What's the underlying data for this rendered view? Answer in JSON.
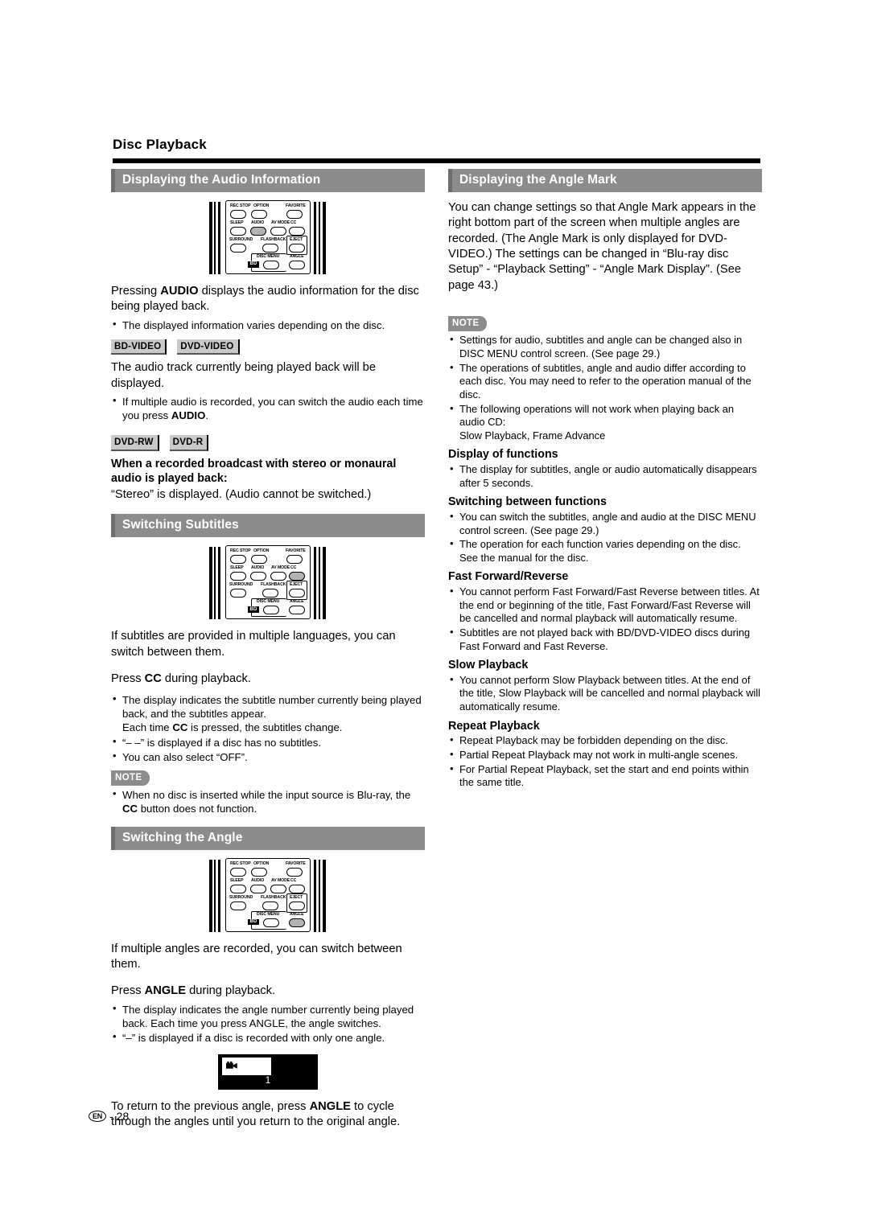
{
  "page": {
    "title": "Disc Playback",
    "footer_locale": "EN",
    "footer_sep": "-",
    "footer_page": "28"
  },
  "remote": {
    "labels": {
      "rec_stop": "REC STOP",
      "option": "OPTION",
      "favorite": "FAVORITE",
      "sleep": "SLEEP",
      "audio": "AUDIO",
      "av_mode": "AV MODE",
      "cc": "CC",
      "surround": "SURROUND",
      "flashback": "FLASHBACK",
      "eject": "EJECT",
      "disc_menu": "DISC MENU",
      "angle": "ANGLE",
      "bd": "BD"
    }
  },
  "left_column": {
    "audio_section": {
      "header": "Displaying the Audio Information",
      "intro_1": "Pressing ",
      "intro_bold": "AUDIO",
      "intro_2": " displays the audio information for the disc being played back.",
      "bullets": [
        "The displayed information varies depending on the disc."
      ],
      "badges_1": [
        "BD-VIDEO",
        "DVD-VIDEO"
      ],
      "para_1": "The audio track currently being played back will be displayed.",
      "bullet_2_a": "If multiple audio is recorded, you can switch the audio each time you press ",
      "bullet_2_bold": "AUDIO",
      "bullet_2_b": ".",
      "badges_2": [
        "DVD-RW",
        "DVD-R"
      ],
      "subhead": "When a recorded broadcast with stereo or monaural audio is played back:",
      "para_2": "“Stereo” is displayed. (Audio cannot be switched.)"
    },
    "subtitles_section": {
      "header": "Switching Subtitles",
      "para_1": "If subtitles are provided in multiple languages, you can switch between them.",
      "press_1": "Press ",
      "press_bold": "CC",
      "press_2": " during playback.",
      "bullet_1_a": "The display indicates the subtitle number currently being played back, and the subtitles appear.",
      "bullet_1_b": "Each time ",
      "bullet_1_bold": "CC",
      "bullet_1_c": " is pressed, the subtitles change.",
      "bullet_2": "“– –” is displayed if a disc has no subtitles.",
      "bullet_3": "You can also select “OFF”.",
      "note_label": "NOTE",
      "note_bullet_a": "When no disc is inserted while the input source is Blu-ray, the ",
      "note_bullet_bold": "CC",
      "note_bullet_b": " button does not function."
    },
    "angle_section": {
      "header": "Switching the Angle",
      "para_1": "If multiple angles are recorded, you can switch between them.",
      "press_1": "Press ",
      "press_bold": "ANGLE",
      "press_2": " during playback.",
      "bullet_1": "The display indicates the angle number currently being played back. Each time you press ANGLE, the angle switches.",
      "bullet_2": "“–” is displayed if a disc is recorded with only one angle.",
      "angle_mark_number": "1",
      "closing_1": "To return to the previous angle, press ",
      "closing_bold": "ANGLE",
      "closing_2": " to cycle through the angles until you return to the original angle."
    }
  },
  "right_column": {
    "angle_mark_section": {
      "header": "Displaying the Angle Mark",
      "para_1": "You can change settings so that Angle Mark appears in the right bottom part of the screen when multiple angles are recorded. (The Angle Mark is only displayed for DVD-VIDEO.) The settings can be changed in “Blu-ray disc Setup” - “Playback Setting” - “Angle Mark Display”. (See page 43.)",
      "note_label": "NOTE",
      "note_bullets": [
        "Settings for audio, subtitles and angle can be changed also in DISC MENU control screen. (See page 29.)",
        "The operations of subtitles, angle and audio differ according to each disc. You may need to refer to the operation manual of the disc.",
        "The following operations will not work when playing back an audio CD:"
      ],
      "note_bullet_3_extra": "Slow Playback, Frame Advance",
      "groups": [
        {
          "title": "Display of functions",
          "bullets": [
            "The display for subtitles, angle or audio automatically disappears after 5 seconds."
          ]
        },
        {
          "title": "Switching between functions",
          "bullets": [
            "You can switch the subtitles, angle and audio at the DISC MENU control screen. (See page 29.)",
            "The operation for each function varies depending on the disc. See the manual for the disc."
          ]
        },
        {
          "title": "Fast Forward/Reverse",
          "bullets": [
            "You cannot perform Fast Forward/Fast Reverse between titles. At the end or beginning of the title, Fast Forward/Fast Reverse will be cancelled and normal playback will automatically resume.",
            "Subtitles are not played back with BD/DVD-VIDEO discs during Fast Forward and Fast Reverse."
          ]
        },
        {
          "title": "Slow Playback",
          "bullets": [
            "You cannot perform Slow Playback between titles. At the end of the title, Slow Playback will be cancelled and normal playback will automatically resume."
          ]
        },
        {
          "title": "Repeat Playback",
          "bullets": [
            "Repeat Playback may be forbidden depending on the disc.",
            "Partial Repeat Playback may not work in multi-angle scenes.",
            "For Partial Repeat Playback, set the start and end points within the same title."
          ]
        }
      ]
    }
  },
  "colors": {
    "header_bar": "#8c8c8c",
    "header_accent": "#6e6e6e",
    "badge_bg": "#c9c9c9",
    "button_highlight": "#b3b3b3"
  }
}
